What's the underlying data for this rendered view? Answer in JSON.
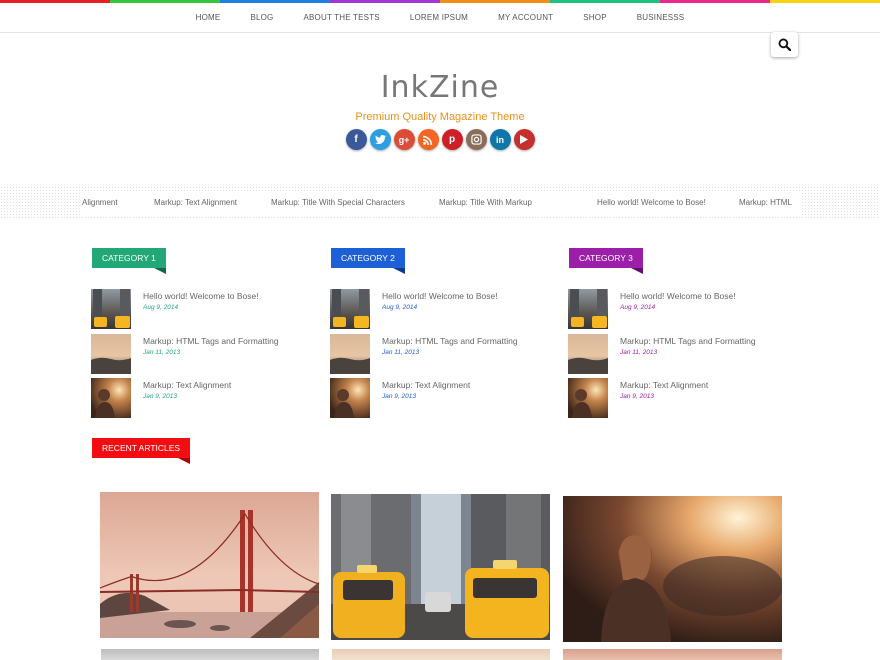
{
  "colors": {
    "strip": [
      "#e62024",
      "#36c63b",
      "#1d7fe3",
      "#a336d8",
      "#f28d1b",
      "#1fc27c",
      "#e8288a",
      "#f5d312"
    ],
    "accent_orange": "#e8911b",
    "category1": "#22a876",
    "category2": "#1d5fd6",
    "category3": "#9b1fa8",
    "recent": "#f10d12"
  },
  "nav": {
    "items": [
      "HOME",
      "BLOG",
      "ABOUT THE TESTS",
      "LOREM IPSUM",
      "MY ACCOUNT",
      "SHOP",
      "BUSINESSS"
    ]
  },
  "search": {
    "icon": "search-icon"
  },
  "header": {
    "title": "InkZine",
    "tagline": "Premium Quality Magazine Theme",
    "social": [
      "facebook",
      "twitter",
      "google-plus",
      "rss",
      "pinterest",
      "instagram",
      "linkedin",
      "youtube"
    ]
  },
  "ticker": {
    "items": [
      "t Alignment",
      "Markup: Text Alignment",
      "Markup: Title With Special Characters",
      "Markup: Title With Markup",
      "Hello world! Welcome to Bose!",
      "Markup: HTML"
    ]
  },
  "categories": [
    {
      "label": "CATEGORY 1",
      "posts": [
        {
          "title": "Hello world! Welcome to Bose!",
          "date": "Aug 9, 2014"
        },
        {
          "title": "Markup: HTML Tags and Formatting",
          "date": "Jan 11, 2013"
        },
        {
          "title": "Markup: Text Alignment",
          "date": "Jan 9, 2013"
        }
      ]
    },
    {
      "label": "CATEGORY 2",
      "posts": [
        {
          "title": "Hello world! Welcome to Bose!",
          "date": "Aug 9, 2014"
        },
        {
          "title": "Markup: HTML Tags and Formatting",
          "date": "Jan 11, 2013"
        },
        {
          "title": "Markup: Text Alignment",
          "date": "Jan 9, 2013"
        }
      ]
    },
    {
      "label": "CATEGORY 3",
      "posts": [
        {
          "title": "Hello world! Welcome to Bose!",
          "date": "Aug 9, 2014"
        },
        {
          "title": "Markup: HTML Tags and Formatting",
          "date": "Jan 11, 2013"
        },
        {
          "title": "Markup: Text Alignment",
          "date": "Jan 9, 2013"
        }
      ]
    }
  ],
  "recent": {
    "label": "RECENT ARTICLES"
  }
}
